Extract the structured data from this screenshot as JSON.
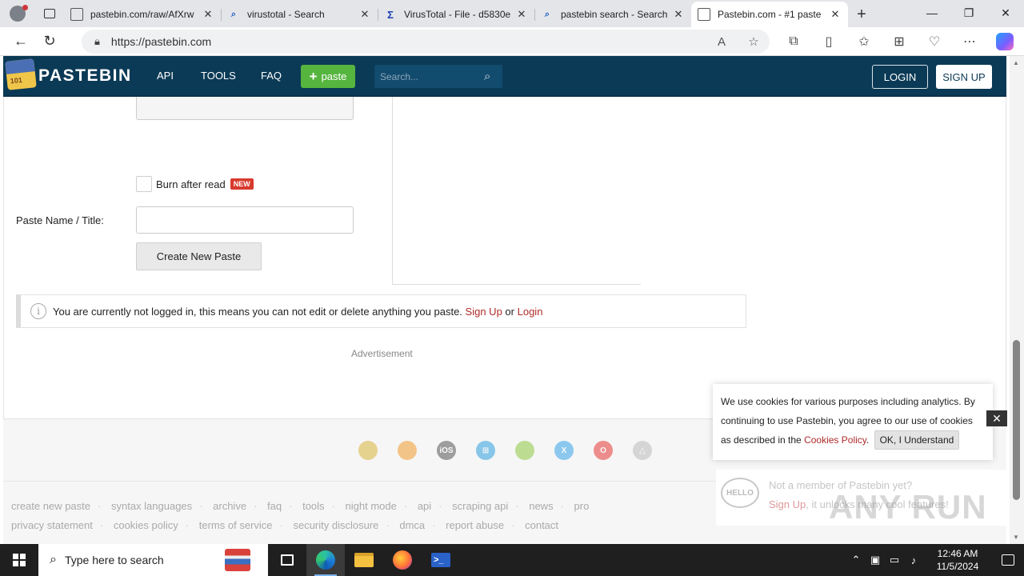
{
  "browser": {
    "tabs": [
      {
        "title": "pastebin.com/raw/AfXrw",
        "icon": "page-icon",
        "active": false
      },
      {
        "title": "virustotal - Search",
        "icon": "search-icon",
        "active": false
      },
      {
        "title": "VirusTotal - File - d5830e",
        "icon": "virustotal-icon",
        "active": false
      },
      {
        "title": "pastebin search - Search",
        "icon": "search-icon",
        "active": false
      },
      {
        "title": "Pastebin.com - #1 paste",
        "icon": "page-icon",
        "active": true
      }
    ],
    "url": "https://pastebin.com"
  },
  "pastebin": {
    "brand": "PASTEBIN",
    "logo_text": "101",
    "nav": [
      "API",
      "TOOLS",
      "FAQ"
    ],
    "paste_button": "paste",
    "search_placeholder": "Search...",
    "login": "LOGIN",
    "signup": "SIGN UP",
    "burn_after_read": "Burn after read",
    "new_badge": "NEW",
    "title_label": "Paste Name / Title:",
    "title_value": "",
    "create_button": "Create New Paste",
    "notice_text": "You are currently not logged in, this means you can not edit or delete anything you paste.",
    "notice_signup": "Sign Up",
    "notice_or": "or",
    "notice_login": "Login",
    "advertisement": "Advertisement",
    "footer_links_row1": [
      "create new paste",
      "syntax languages",
      "archive",
      "faq",
      "tools",
      "night mode",
      "api",
      "scraping api",
      "news",
      "pro"
    ],
    "footer_links_row2": [
      "privacy statement",
      "cookies policy",
      "terms of service",
      "security disclosure",
      "dmca",
      "report abuse",
      "contact"
    ],
    "app_icons": [
      "chrome",
      "firefox",
      "iOS",
      "windows",
      "android",
      "macos",
      "opera",
      "linux"
    ]
  },
  "cookie": {
    "text_before": "We use cookies for various purposes including analytics. By continuing to use Pastebin, you agree to our use of cookies as described in the",
    "link": "Cookies Policy",
    "period": ".",
    "ok": "OK, I Understand"
  },
  "promo": {
    "hello": "HELLO",
    "question": "Not a member of Pastebin yet?",
    "signup": "Sign Up",
    "rest": ", it unlocks many cool features!"
  },
  "watermark": "ANY RUN",
  "taskbar": {
    "search_placeholder": "Type here to search",
    "time": "12:46 AM",
    "date": "11/5/2024"
  },
  "colors": {
    "header": "#0b3a56",
    "paste_green": "#56b53e",
    "link_red": "#b02a2a"
  }
}
